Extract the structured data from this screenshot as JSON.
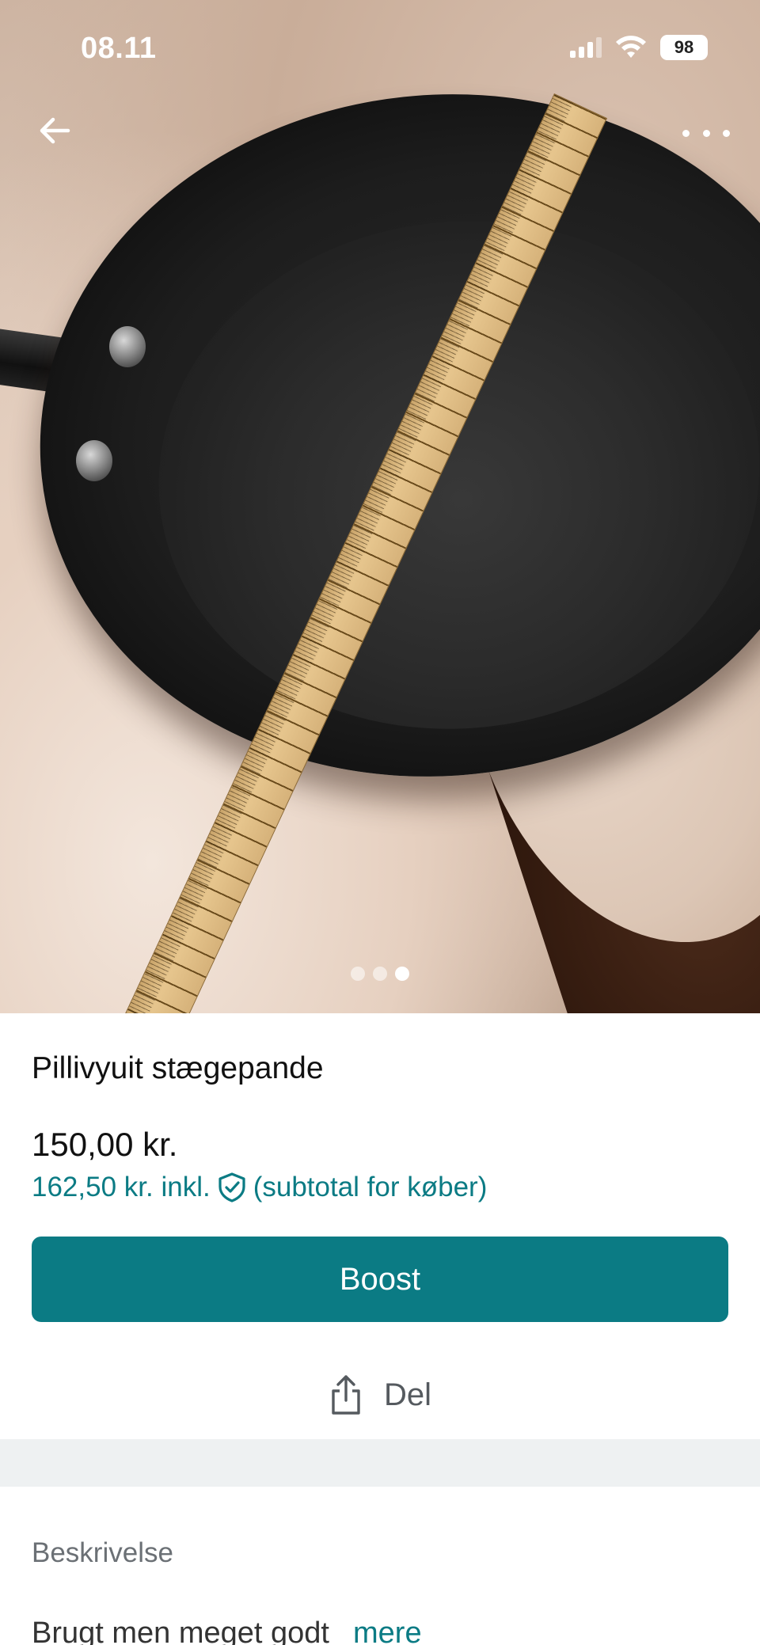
{
  "status_bar": {
    "time": "08.11",
    "battery": "98"
  },
  "photo": {
    "current_index": 3,
    "total": 3,
    "icons": {
      "back": "arrow-left-icon",
      "more": "more-horizontal-icon"
    }
  },
  "listing": {
    "title": "Pillivyuit stægepande",
    "price": "150,00 kr.",
    "subtotal_prefix": "162,50 kr. inkl.",
    "subtotal_suffix": "(subtotal for køber)",
    "boost_label": "Boost",
    "share_label": "Del"
  },
  "description": {
    "heading": "Beskrivelse",
    "text": "Brugt men meget godt",
    "more_label": "mere"
  },
  "colors": {
    "accent": "#0b7b84",
    "divider": "#eef1f2"
  }
}
